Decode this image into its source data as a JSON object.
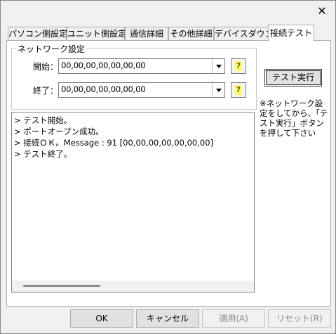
{
  "window": {
    "close_glyph": "✕"
  },
  "tabs": [
    {
      "label": "パソコン側設定"
    },
    {
      "label": "ユニット側設定"
    },
    {
      "label": "通信詳細"
    },
    {
      "label": "その他詳細"
    },
    {
      "label": "デバイスダウン"
    },
    {
      "label": "接続テスト"
    }
  ],
  "active_tab": 5,
  "network": {
    "group_title": "ネットワーク設定",
    "start_label": "開始：",
    "start_value": "00,00,00,00,00,00,00",
    "end_label": "終了：",
    "end_value": "00,00,00,00,00,00,00",
    "help_glyph": "?"
  },
  "test_button": {
    "label": "テスト実行"
  },
  "note": "※ネットワーク設定をしてから、「テスト実行」ボタンを押して下さい",
  "log": [
    "> テスト開始。",
    "> ポートオープン成功。",
    "> 接続ＯＫ。Message : 91 [00,00,00,00,00,00,00]",
    "> テスト終了。"
  ],
  "buttons": {
    "ok": "OK",
    "cancel": "キャンセル",
    "apply": "適用(A)",
    "reset": "リセット(R)"
  }
}
